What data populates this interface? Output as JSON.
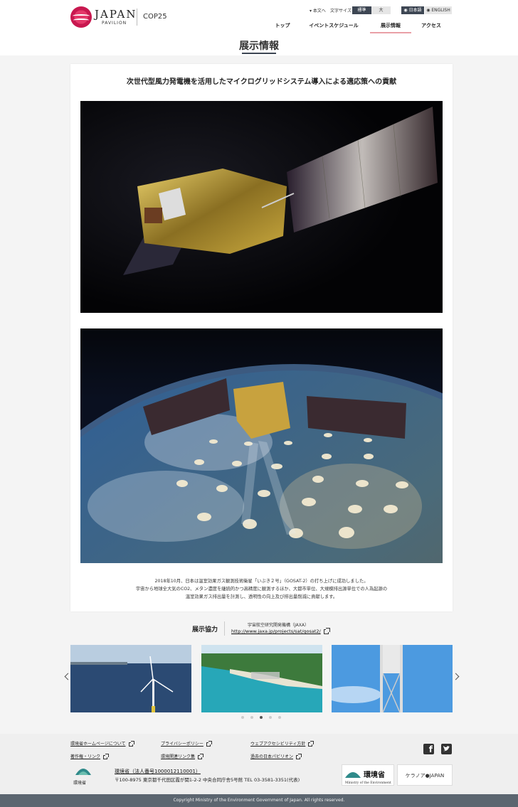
{
  "header": {
    "logo_text": "JAPAN",
    "logo_sub": "PAVILION",
    "event": "COP25",
    "skip_link": "▾ 本文へ",
    "font_size_label": "文字サイズ",
    "font_size_standard": "標準",
    "font_size_large": "大",
    "lang_ja": "◉ 日本語",
    "lang_en": "◉ ENGLISH",
    "nav": [
      "トップ",
      "イベントスケジュール",
      "展示情報",
      "アクセス"
    ],
    "active_nav": "展示情報"
  },
  "page": {
    "title": "展示情報",
    "heading": "次世代型風力発電機を活用したマイクログリッドシステム導入による適応策への貢献",
    "description": [
      "2018年10月、日本は温室効果ガス観測技術衛星「いぶき２号」（GOSAT-2）の打ち上げに成功しました。",
      "宇宙から地球全大気のCO2、メタン濃度を継続的かつ高精度に観測するほか、大都市単位、大規模排出源単位での人為起源の",
      "温室効果ガス排出量を計測し、透明性の向上及び排出量削減に貢献します。"
    ]
  },
  "cooperation": {
    "label": "展示協力",
    "org": "宇宙航空研究開発機構（JAXA）",
    "url": "http://www.jaxa.jp/projects/sat/gosat2/"
  },
  "carousel": {
    "slides": [
      "wind-turbine-sea",
      "island-coast",
      "tower-sky"
    ],
    "dots": 5,
    "active_dot": 2
  },
  "footer": {
    "links": [
      "環境省ホームページについて",
      "プライバシーポリシー",
      "ウェブアクセシビリティ方針",
      "著作権・リンク",
      "環境関連リンク集",
      "過去の日本パビリオン"
    ],
    "moe_label": "環境省",
    "moe_name": "環境省（法人番号1000012110001）",
    "moe_address": "〒100-8975 東京都千代田区霞が関1-2-2 中央合同庁舎5号館 TEL 03-3581-3351(代表)",
    "badge_moe": "環境省",
    "badge_moe_en": "Ministry of the Environment",
    "badge_cool": "ケラノア●JAPAN",
    "copyright": "Copyright Ministry of the Environment Government of Japan. All rights reserved."
  },
  "colors": {
    "nav_accent": "#e9a0a6",
    "dark": "#3d4653",
    "footer_bar": "#5c6670"
  }
}
